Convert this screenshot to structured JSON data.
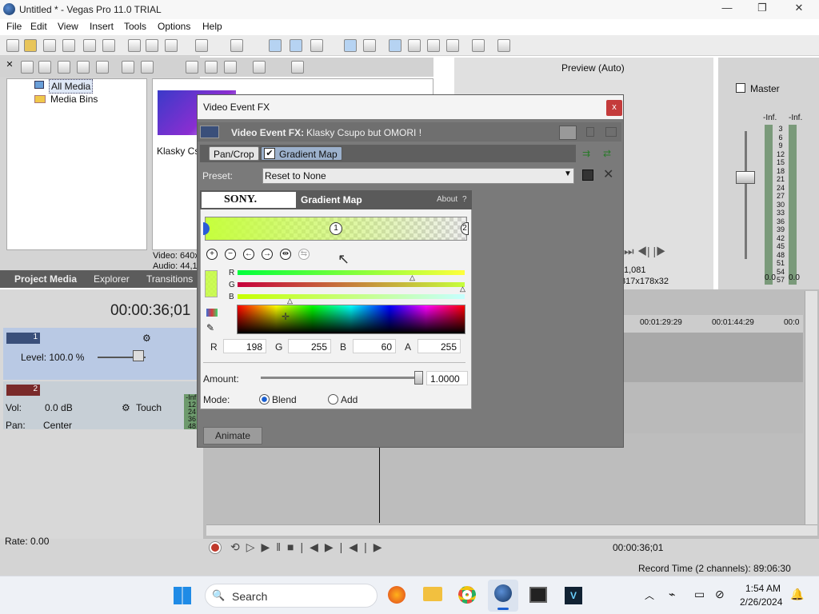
{
  "window": {
    "title": "Untitled * - Vegas Pro 11.0 TRIAL",
    "minimize": "—",
    "maximize": "❐",
    "close": "✕"
  },
  "menu": [
    "File",
    "Edit",
    "View",
    "Insert",
    "Tools",
    "Options",
    "Help"
  ],
  "media": {
    "tree": [
      "All Media",
      "Media Bins"
    ],
    "thumb_label": "Klasky Csu",
    "video_info": "Video: 640x",
    "audio_info": "Audio: 44,1"
  },
  "tabs": [
    "Project Media",
    "Explorer",
    "Transitions"
  ],
  "preview": {
    "mode": "Preview (Auto)",
    "frame": "1,081",
    "size": "317x178x32"
  },
  "master": {
    "title": "Master",
    "inf_left": "-Inf.",
    "inf_right": "-Inf.",
    "val_left": "0.0",
    "val_right": "0.0",
    "scale": [
      "3",
      "6",
      "9",
      "12",
      "15",
      "18",
      "21",
      "24",
      "27",
      "30",
      "33",
      "36",
      "39",
      "42",
      "45",
      "48",
      "51",
      "54",
      "57"
    ]
  },
  "timeline": {
    "timecode": "00:00:36;01",
    "ruler": [
      "00:01:29:29",
      "00:01:44:29",
      "00:0"
    ],
    "track1": {
      "number": "1",
      "level": "Level: 100.0 %"
    },
    "track2": {
      "number": "2",
      "vol_label": "Vol:",
      "vol": "0.0 dB",
      "touch": "Touch",
      "pan_label": "Pan:",
      "pan": "Center",
      "meter": [
        "-Inf.",
        "12",
        "24",
        "36",
        "48"
      ]
    }
  },
  "transport": {
    "rate": "Rate: 0.00",
    "timecode": "00:00:36;01"
  },
  "status": {
    "record_time": "Record Time (2 channels): 89:06:30"
  },
  "dialog": {
    "title": "Video Event FX",
    "close": "x",
    "fx_label": "Video Event FX:",
    "fx_name": "Klasky Csupo but OMORI !",
    "chain": [
      "Pan/Crop",
      "Gradient Map"
    ],
    "preset_label": "Preset:",
    "preset_value": "Reset to None",
    "sony": "SONY.",
    "plugin_name": "Gradient Map",
    "about": "About",
    "about_q": "?",
    "stops": [
      "1",
      "2"
    ],
    "rgb_rows": [
      "R",
      "G",
      "B"
    ],
    "fields": {
      "r_label": "R",
      "r": "198",
      "g_label": "G",
      "g": "255",
      "b_label": "B",
      "b": "60",
      "a_label": "A",
      "a": "255"
    },
    "amount_label": "Amount:",
    "amount": "1.0000",
    "amount_level": 1.0,
    "mode_label": "Mode:",
    "mode_blend": "Blend",
    "mode_add": "Add",
    "animate": "Animate",
    "gradient_color": "#c6ff3c"
  },
  "taskbar": {
    "search": "Search",
    "time": "1:54 AM",
    "date": "2/26/2024"
  }
}
